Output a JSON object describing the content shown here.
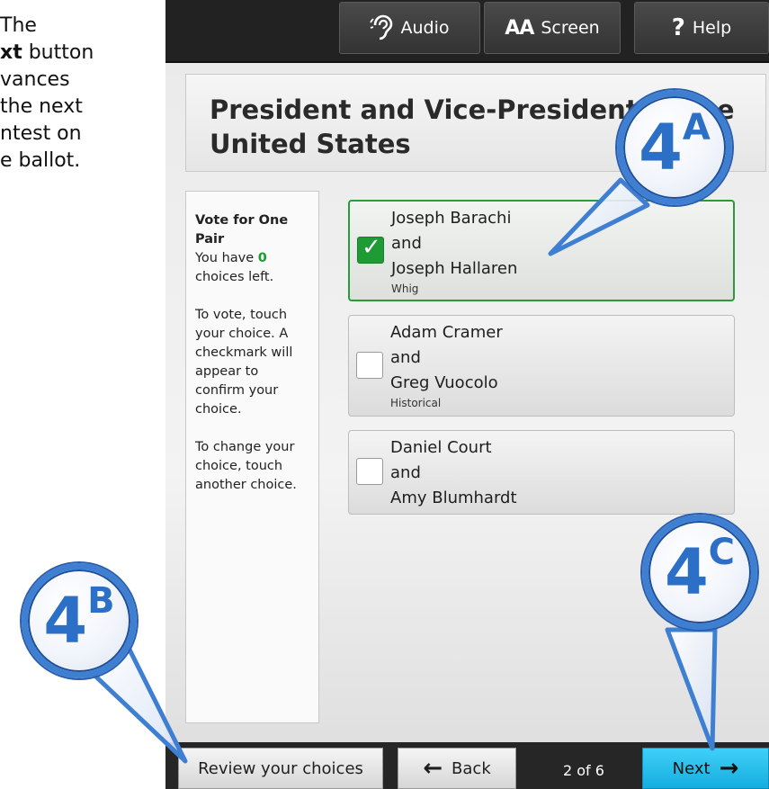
{
  "caption": {
    "lines": [
      {
        "pre": "The",
        "bold": "",
        "post": ""
      },
      {
        "pre": "",
        "bold": "xt",
        "post": " button"
      },
      {
        "pre": "vances",
        "bold": "",
        "post": ""
      },
      {
        "pre": "the next",
        "bold": "",
        "post": ""
      },
      {
        "pre": "ntest on",
        "bold": "",
        "post": ""
      },
      {
        "pre": "e ballot.",
        "bold": "",
        "post": ""
      }
    ]
  },
  "toolbar": {
    "audio_label": "Audio",
    "screen_icon": "AA",
    "screen_label": "Screen",
    "help_icon": "?",
    "help_label": "Help"
  },
  "contest": {
    "title_line1": "President and Vice-President of the",
    "title_line2": "United States"
  },
  "instructions": {
    "vote_for": "Vote for One Pair",
    "remaining_prefix": "You have ",
    "remaining_count": "0",
    "remaining_suffix": " choices left.",
    "how_to_vote": "To vote, touch your choice.  A checkmark will appear to confirm your choice.",
    "how_to_change": "To change your choice, touch another choice."
  },
  "choices": [
    {
      "name1": "Joseph Barachi",
      "and": "and",
      "name2": "Joseph Hallaren",
      "party": "Whig",
      "selected": true
    },
    {
      "name1": "Adam Cramer",
      "and": "and",
      "name2": "Greg Vuocolo",
      "party": "Historical",
      "selected": false
    },
    {
      "name1": "Daniel Court",
      "and": "and",
      "name2": "Amy Blumhardt",
      "party": "",
      "selected": false
    }
  ],
  "footer": {
    "review_label": "Review your choices",
    "back_label": "Back",
    "page_indicator": "2 of 6",
    "next_label": "Next"
  },
  "callouts": {
    "a": {
      "num": "4",
      "letter": "A"
    },
    "b": {
      "num": "4",
      "letter": "B"
    },
    "c": {
      "num": "4",
      "letter": "C"
    }
  },
  "colors": {
    "accent_blue": "#3f7fd2",
    "selected_green": "#1e9b35",
    "next_button": "#15aee0"
  }
}
